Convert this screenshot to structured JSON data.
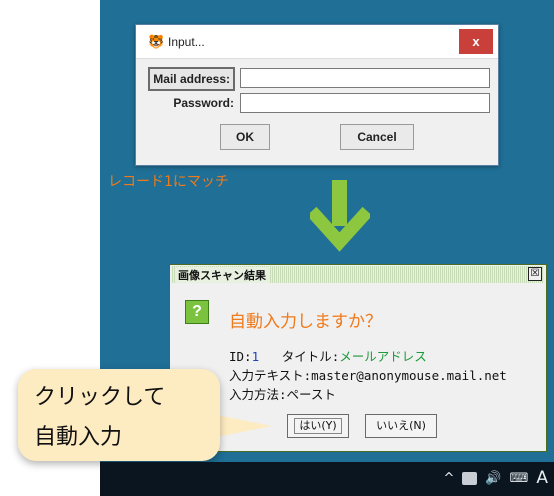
{
  "input_dialog": {
    "title": "Input...",
    "close_label": "x",
    "mail_label": "Mail address:",
    "password_label": "Password:",
    "mail_value": "",
    "password_value": "",
    "ok_label": "OK",
    "cancel_label": "Cancel"
  },
  "match_note": "レコード1にマッチ",
  "scan_dialog": {
    "title": "画像スキャン結果",
    "close_label": "☒",
    "icon_text": "?",
    "question": "自動入力しますか？",
    "id_label": "ID:",
    "id_value": "1",
    "title_label": "タイトル:",
    "title_value": "メールアドレス",
    "input_text_label": "入力テキスト:",
    "input_text_value": "master@anonymouse.mail.net",
    "method_label": "入力方法:",
    "method_value": "ペースト",
    "yes_label": "はい(Y)",
    "no_label": "いいえ(N)"
  },
  "callout": {
    "line1": "クリックして",
    "line2": "自動入力"
  },
  "taskbar": {
    "chevron": "^",
    "volume": "🔊",
    "keyboard": "⌨",
    "ime": "A"
  },
  "colors": {
    "desktop": "#1f6f96",
    "accent_orange": "#f07a1a",
    "arrow_green": "#8dc63f",
    "close_red": "#c9403a"
  },
  "icons": [
    "app-icon",
    "close-icon",
    "down-arrow-icon",
    "question-icon",
    "chevron-up-icon",
    "network-icon",
    "volume-icon",
    "keyboard-icon"
  ]
}
